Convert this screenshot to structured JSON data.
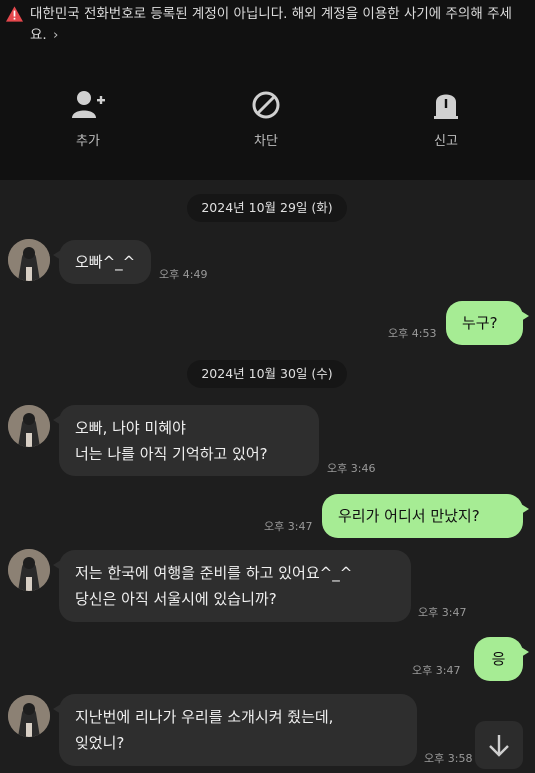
{
  "notice": {
    "text": "대한민국 전화번호로 등록된 계정이 아닙니다. 해외 계정을 이용한 사기에 주의해 주세요.",
    "chevron": "›",
    "icon": "warning-triangle-icon",
    "icon_color": "#e5484d"
  },
  "actions": [
    {
      "label": "추가",
      "icon": "add-friend-icon"
    },
    {
      "label": "차단",
      "icon": "block-icon"
    },
    {
      "label": "신고",
      "icon": "report-icon"
    }
  ],
  "dates": [
    "2024년 10월 29일 (화)",
    "2024년 10월 30일 (수)"
  ],
  "messages": [
    {
      "dir": "in",
      "lines": [
        "오빠^_^"
      ],
      "time": "오후 4:49"
    },
    {
      "dir": "out",
      "lines": [
        "누구?"
      ],
      "time": "오후 4:53"
    },
    {
      "dir": "in",
      "lines": [
        "오빠, 나야 미혜야",
        "너는 나를 아직 기억하고 있어?"
      ],
      "time": "오후 3:46"
    },
    {
      "dir": "out",
      "lines": [
        "우리가 어디서 만났지?"
      ],
      "time": "오후 3:47"
    },
    {
      "dir": "in",
      "lines": [
        "저는 한국에 여행을 준비를 하고 있어요^_^",
        "당신은 아직 서울시에 있습니까?"
      ],
      "time": "오후 3:47"
    },
    {
      "dir": "out",
      "lines": [
        "응"
      ],
      "time": "오후 3:47"
    },
    {
      "dir": "in",
      "lines": [
        "지난번에 리나가 우리를 소개시켜 줬는데,",
        "잊었니?"
      ],
      "time": "오후 3:58"
    }
  ],
  "scroll_button": {
    "icon": "arrow-down-icon"
  },
  "colors": {
    "outgoing_bubble": "#a6ec94",
    "incoming_bubble": "#2e2e2e",
    "background": "#1e1e1e",
    "header": "#111111"
  }
}
